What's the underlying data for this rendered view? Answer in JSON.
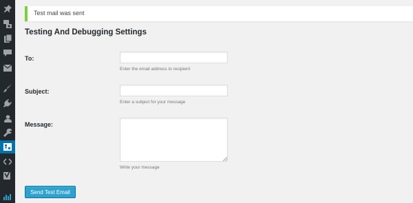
{
  "sidebar": {
    "icons": [
      "pin-icon",
      "media-icon",
      "pages-icon",
      "comments-icon",
      "mail-icon",
      "brush-icon",
      "plugins-icon",
      "users-icon",
      "tools-icon",
      "settings-icon",
      "code-icon",
      "seo-icon",
      "analytics-icon"
    ],
    "active_icon": "settings-icon"
  },
  "notice": {
    "text": "Test mail was sent"
  },
  "page": {
    "heading": "Testing And Debugging Settings"
  },
  "form": {
    "to": {
      "label": "To:",
      "value": "",
      "hint": "Enter the email address to recipient"
    },
    "subject": {
      "label": "Subject:",
      "value": "",
      "hint": "Enter a subject for your message"
    },
    "message": {
      "label": "Message:",
      "value": "",
      "hint": "Write your message"
    },
    "submit_label": "Send Test Email"
  },
  "colors": {
    "sidebar_bg": "#23282d",
    "active_menu": "#0073aa",
    "notice_border": "#7ad03a",
    "button_bg": "#2ea2cc"
  }
}
